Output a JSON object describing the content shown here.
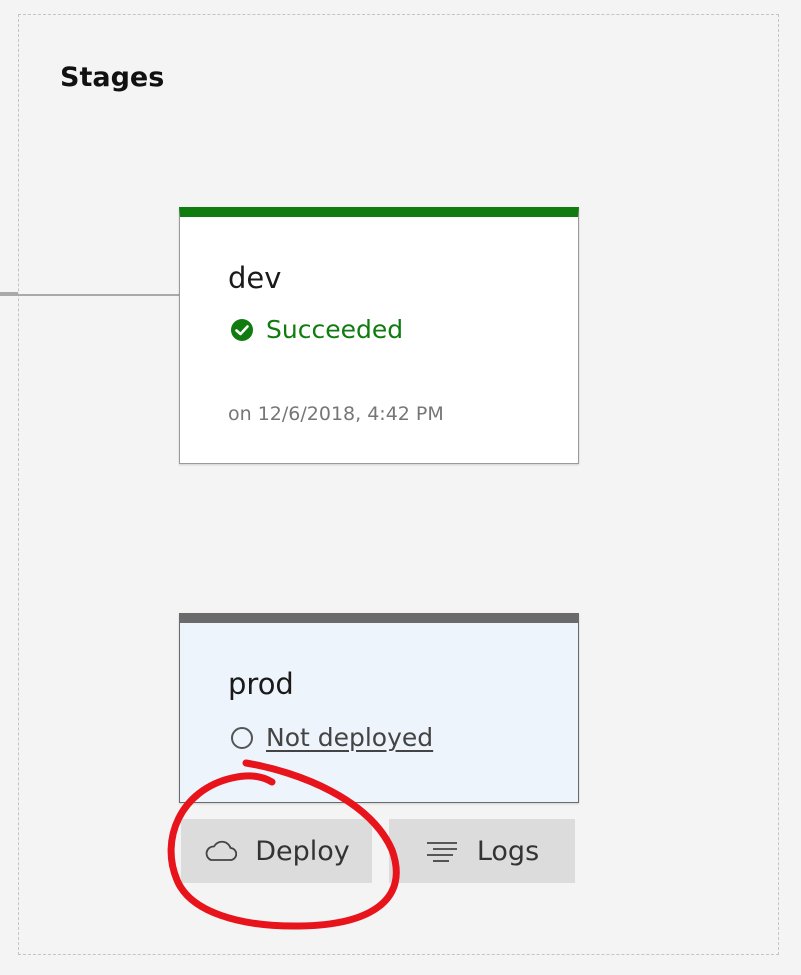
{
  "section": {
    "title": "Stages"
  },
  "stages": [
    {
      "name": "dev",
      "status": "Succeeded",
      "timestamp": "on 12/6/2018, 4:42 PM",
      "accent": "#107c10"
    },
    {
      "name": "prod",
      "status": "Not deployed",
      "accent": "#666666"
    }
  ],
  "actions": {
    "deploy_label": "Deploy",
    "deploy_icon": "cloud-icon",
    "logs_label": "Logs",
    "logs_icon": "logs-icon"
  },
  "annotation": {
    "color": "#e8141b",
    "shape": "hand-drawn-circle"
  }
}
